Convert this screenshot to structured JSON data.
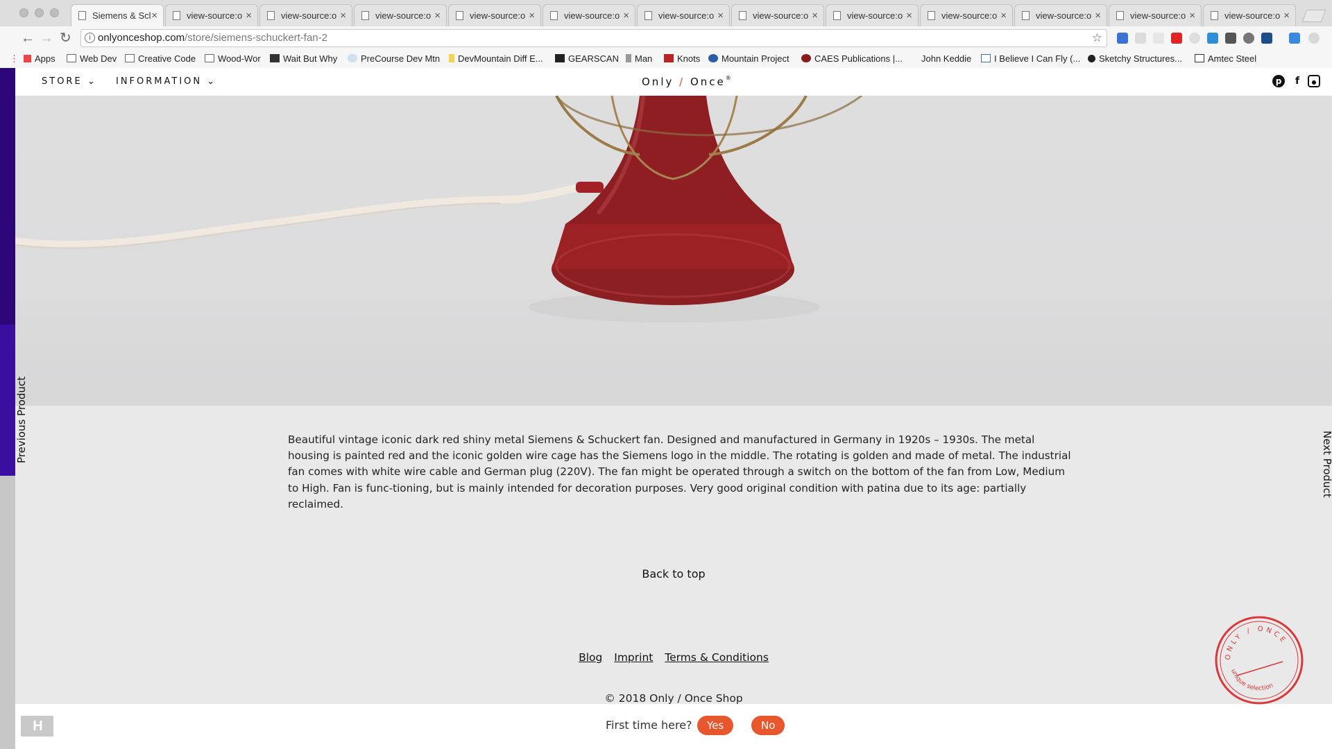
{
  "browser": {
    "tabs": [
      {
        "title": "Siemens & Scl",
        "active": true
      },
      {
        "title": "view-source:o"
      },
      {
        "title": "view-source:o"
      },
      {
        "title": "view-source:o"
      },
      {
        "title": "view-source:o"
      },
      {
        "title": "view-source:o"
      },
      {
        "title": "view-source:o"
      },
      {
        "title": "view-source:o"
      },
      {
        "title": "view-source:o"
      },
      {
        "title": "view-source:o"
      },
      {
        "title": "view-source:o"
      },
      {
        "title": "view-source:o"
      },
      {
        "title": "view-source:o"
      }
    ],
    "url_host": "onlyonceshop.com",
    "url_path": "/store/siemens-schuckert-fan-2",
    "bookmarks": [
      {
        "label": "Apps",
        "icon": "apps-grid-icon"
      },
      {
        "label": "Web Dev",
        "icon": "folder-icon"
      },
      {
        "label": "Creative Code",
        "icon": "folder-icon"
      },
      {
        "label": "Wood-Wor",
        "icon": "folder-icon"
      },
      {
        "label": "Wait But Why",
        "icon": "site-icon"
      },
      {
        "label": "PreCourse Dev Mtn",
        "icon": "site-icon"
      },
      {
        "label": "DevMountain Diff E...",
        "icon": "site-icon"
      },
      {
        "label": "GEARSCAN",
        "icon": "site-icon"
      },
      {
        "label": "Man",
        "icon": "site-icon"
      },
      {
        "label": "Knots",
        "icon": "site-icon"
      },
      {
        "label": "Mountain Project",
        "icon": "site-icon"
      },
      {
        "label": "CAES Publications |...",
        "icon": "site-icon"
      },
      {
        "label": "John Keddie",
        "icon": "none"
      },
      {
        "label": "I Believe I Can Fly (...",
        "icon": "site-icon"
      },
      {
        "label": "Sketchy Structures...",
        "icon": "site-icon"
      },
      {
        "label": "Amtec Steel",
        "icon": "site-icon"
      }
    ]
  },
  "site": {
    "nav": {
      "store": "STORE",
      "information": "INFORMATION",
      "logo_left": "Only",
      "logo_slash": "/",
      "logo_right": "Once",
      "logo_mark": "®"
    },
    "social": [
      "pinterest-icon",
      "facebook-icon",
      "instagram-icon"
    ],
    "previous": "Previous Product",
    "next": "Next Product",
    "description": "Beautiful vintage iconic dark red shiny metal Siemens & Schuckert fan. Designed and manufactured in Germany in 1920s – 1930s. The metal housing is painted red and the iconic golden wire cage has the Siemens logo in the middle. The rotating is golden and made of metal. The industrial fan comes with white wire cable and German plug (220V). The fan might be operated through a switch on the bottom of the fan from Low, Medium to High. Fan is func-tioning, but is mainly intended for decoration purposes. Very good original condition with patina due to its age: partially reclaimed.",
    "back_to_top": "Back to top",
    "footer_links": [
      "Blog",
      "Imprint",
      "Terms & Conditions"
    ],
    "copyright": "© 2018 Only / Once Shop",
    "stamp": {
      "top": "ONLY / ONCE",
      "bottom": "unique selection"
    },
    "first_time": {
      "question": "First time here?",
      "yes": "Yes",
      "no": "No"
    }
  },
  "colors": {
    "accent": "#e8562e",
    "fan_red": "#8c1f22",
    "stamp_red": "#d8383a"
  }
}
